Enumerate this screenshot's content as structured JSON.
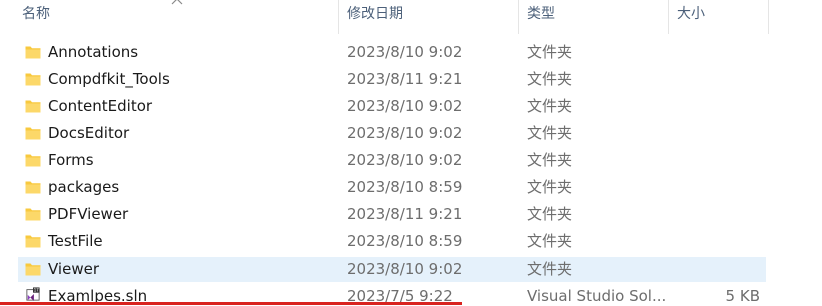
{
  "header": {
    "name_label": "名称",
    "date_label": "修改日期",
    "type_label": "类型",
    "size_label": "大小"
  },
  "files": [
    {
      "name": "Annotations",
      "date": "2023/8/10 9:02",
      "type": "文件夹",
      "size": "",
      "icon": "folder-icon"
    },
    {
      "name": "Compdfkit_Tools",
      "date": "2023/8/11 9:21",
      "type": "文件夹",
      "size": "",
      "icon": "folder-icon"
    },
    {
      "name": "ContentEditor",
      "date": "2023/8/10 9:02",
      "type": "文件夹",
      "size": "",
      "icon": "folder-icon"
    },
    {
      "name": "DocsEditor",
      "date": "2023/8/10 9:02",
      "type": "文件夹",
      "size": "",
      "icon": "folder-icon"
    },
    {
      "name": "Forms",
      "date": "2023/8/10 9:02",
      "type": "文件夹",
      "size": "",
      "icon": "folder-icon"
    },
    {
      "name": "packages",
      "date": "2023/8/10 8:59",
      "type": "文件夹",
      "size": "",
      "icon": "folder-icon"
    },
    {
      "name": "PDFViewer",
      "date": "2023/8/11 9:21",
      "type": "文件夹",
      "size": "",
      "icon": "folder-icon"
    },
    {
      "name": "TestFile",
      "date": "2023/8/10 8:59",
      "type": "文件夹",
      "size": "",
      "icon": "folder-icon"
    },
    {
      "name": "Viewer",
      "date": "2023/8/10 9:02",
      "type": "文件夹",
      "size": "",
      "icon": "folder-icon",
      "selected": true
    },
    {
      "name": "Examlpes.sln",
      "date": "2023/7/5 9:22",
      "type": "Visual Studio Sol...",
      "size": "5 KB",
      "icon": "visual-studio-solution-icon"
    }
  ],
  "colors": {
    "folder": "#f8c93e",
    "selection": "#e5f1fb",
    "underline": "#d9231f"
  }
}
